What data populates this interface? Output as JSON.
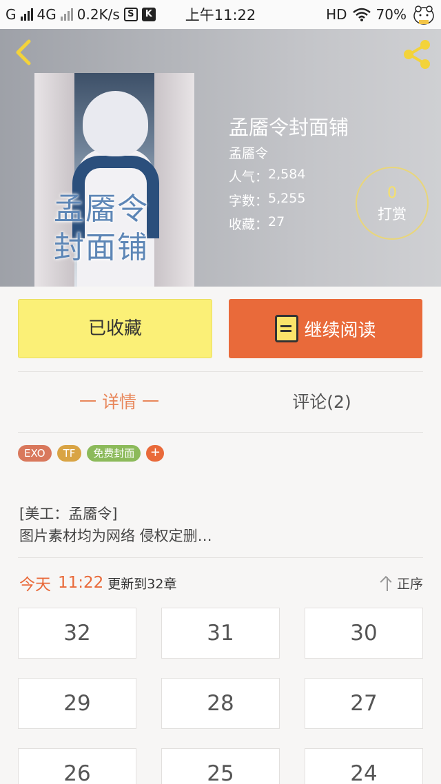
{
  "status_bar": {
    "carrier": "G",
    "network": "4G",
    "speed": "0.2K/s",
    "icon1": "S",
    "icon2": "K",
    "time": "上午11:22",
    "hd": "HD",
    "battery": "70%"
  },
  "header": {
    "book_title": "孟靥令封面铺",
    "author": "孟靥令",
    "popularity_label": "人气：",
    "popularity_value": "2,584",
    "word_count_label": "字数：",
    "word_count_value": "5,255",
    "favorites_label": "收藏：",
    "favorites_value": "27",
    "tip_count": "0",
    "tip_label": "打赏",
    "cover_title": "孟靥令封面铺"
  },
  "actions": {
    "collected_label": "已收藏",
    "continue_label": "继续阅读"
  },
  "tabs": {
    "detail": "一 详情 一",
    "comments": "评论(2)"
  },
  "tags": [
    {
      "label": "EXO",
      "color": "#d9785c"
    },
    {
      "label": "TF",
      "color": "#d9a444"
    },
    {
      "label": "免费封面",
      "color": "#8cba5a"
    }
  ],
  "tag_add": "+",
  "description": {
    "line1": "[美工：孟靥令]",
    "line2": "图片素材均为网络  侵权定删…"
  },
  "update": {
    "today": "今天",
    "time": "11:22",
    "text": "更新到32章",
    "sort_label": "正序"
  },
  "chapters": [
    "32",
    "31",
    "30",
    "29",
    "28",
    "27",
    "26",
    "25",
    "24"
  ],
  "colors": {
    "accent": "#e96a3a",
    "collect_yellow": "#fbf077",
    "tip_yellow": "#f6e06a"
  }
}
